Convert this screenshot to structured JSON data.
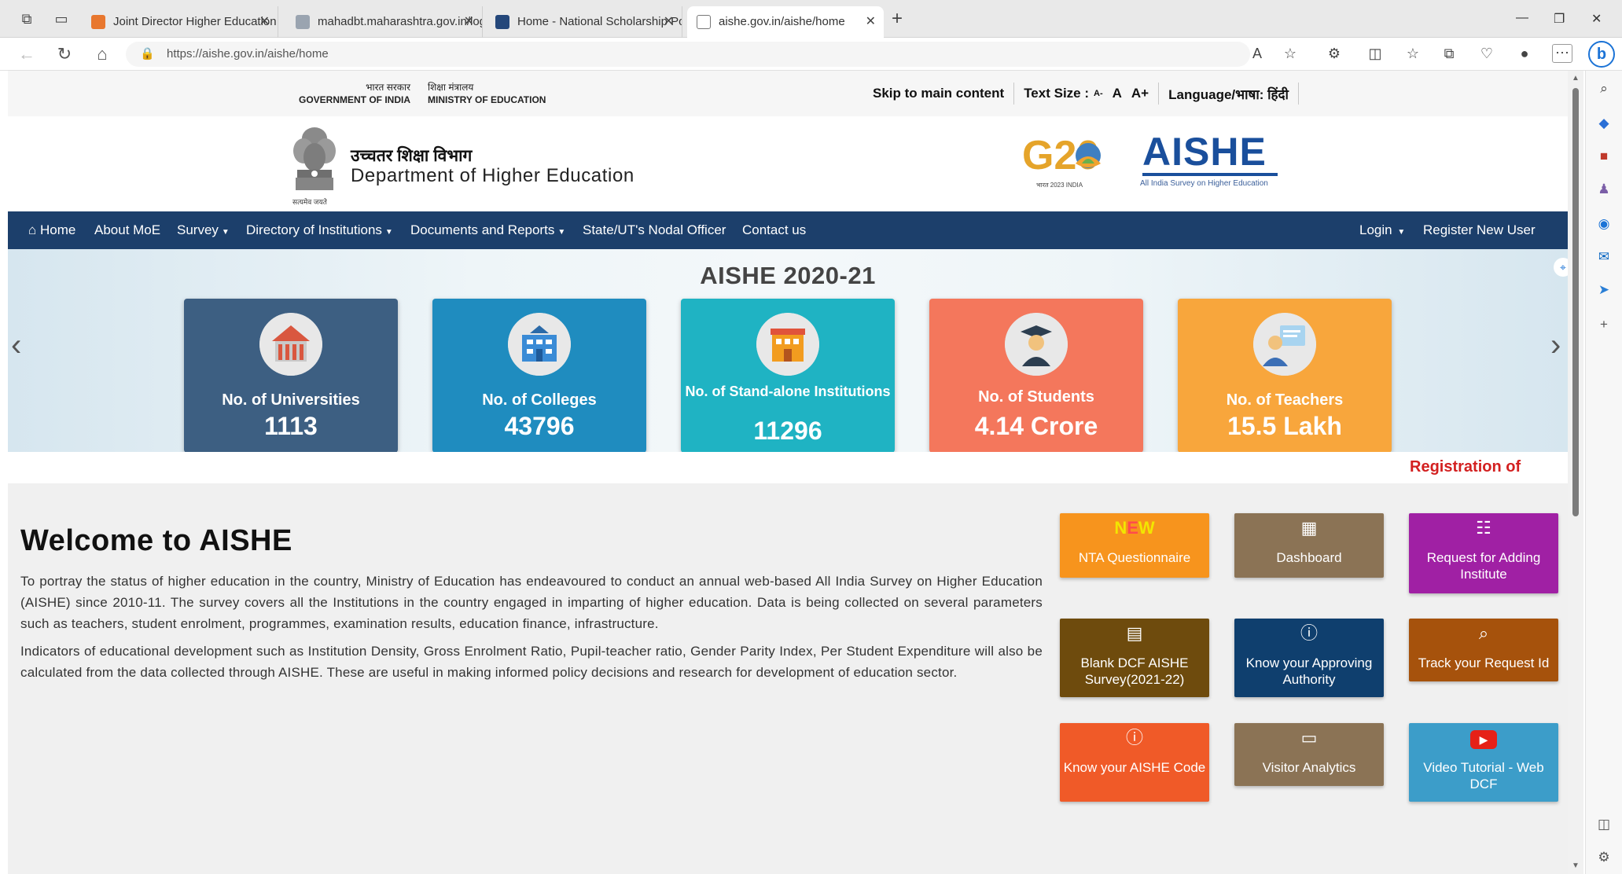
{
  "browser": {
    "tabs": [
      {
        "title": "Joint Director Higher Education ,",
        "favicon_color": "#e8772e",
        "active": false
      },
      {
        "title": "mahadbt.maharashtra.gov.in/log",
        "favicon_color": "#9aa4b0",
        "active": false
      },
      {
        "title": "Home - National Scholarship Por",
        "favicon_color": "#24477a",
        "active": false
      },
      {
        "title": "aishe.gov.in/aishe/home",
        "favicon_color": "#888888",
        "active": true
      }
    ],
    "url": "https://aishe.gov.in/aishe/home"
  },
  "gov": {
    "govt_hi": "भारत सरकार",
    "govt_en": "GOVERNMENT OF INDIA",
    "ministry_hi": "शिक्षा मंत्रालय",
    "ministry_en": "MINISTRY OF EDUCATION",
    "skip": "Skip to main content",
    "text_size": "Text Size :",
    "size_small": "A-",
    "size_normal": "A",
    "size_large": "A+",
    "language": "Language/भाषा: हिंदी"
  },
  "header": {
    "emblem_caption": "सत्यमेव जयते",
    "dept_hi": "उच्चतर शिक्षा विभाग",
    "dept_en": "Department of Higher Education",
    "g20": "G20",
    "g20_caption": "भारत 2023 INDIA",
    "aishe": "AISHE",
    "aishe_sub": "All India Survey on Higher Education"
  },
  "nav": {
    "home": "Home",
    "about": "About MoE",
    "survey": "Survey",
    "directory": "Directory of Institutions",
    "documents": "Documents and Reports",
    "nodal": "State/UT's Nodal Officer",
    "contact": "Contact us",
    "login": "Login",
    "register": "Register New User"
  },
  "slider": {
    "title": "AISHE 2020-21",
    "cards": [
      {
        "label": "No. of Universities",
        "value": "1113",
        "color": "#3d5f82"
      },
      {
        "label": "No. of Colleges",
        "value": "43796",
        "color": "#1f8cbf"
      },
      {
        "label": "No. of Stand-alone Institutions",
        "value": "11296",
        "color": "#1fb3c3"
      },
      {
        "label": "No. of Students",
        "value": "4.14 Crore",
        "color": "#f4775c"
      },
      {
        "label": "No. of Teachers",
        "value": "15.5 Lakh",
        "color": "#f8a63c"
      }
    ]
  },
  "marquee": "Registration of",
  "welcome": {
    "title": "Welcome to AISHE",
    "p1": "To portray the status of higher education in the country, Ministry of Education has endeavoured to conduct an annual web-based All India Survey on Higher Education (AISHE) since 2010-11. The survey covers all the Institutions in the country engaged in imparting of higher education. Data is being collected on several parameters such as teachers, student enrolment, programmes, examination results, education finance, infrastructure.",
    "p2": "Indicators of educational development such as Institution Density, Gross Enrolment Ratio, Pupil-teacher ratio, Gender Parity Index, Per Student Expenditure will also be calculated from the data collected through AISHE. These are useful in making informed policy decisions and research for development of education sector."
  },
  "quick_links": {
    "nta": {
      "label": "NTA Questionnaire",
      "badge_n": "N",
      "badge_e": "E",
      "badge_w": "W",
      "color": "#f7941d"
    },
    "dashboard": {
      "label": "Dashboard",
      "color": "#8b7355"
    },
    "request": {
      "label": "Request for Adding Institute",
      "color": "#a020a4"
    },
    "blank_dcf": {
      "label": "Blank DCF AISHE Survey(2021-22)",
      "color": "#6e4b0d"
    },
    "approving": {
      "label": "Know your Approving Authority",
      "color": "#0f3f6e"
    },
    "track": {
      "label": "Track your Request Id",
      "color": "#a6520c"
    },
    "aishe_code": {
      "label": "Know your AISHE Code",
      "color": "#f05a28"
    },
    "visitor": {
      "label": "Visitor Analytics",
      "color": "#8b7355"
    },
    "video": {
      "label": "Video Tutorial - Web DCF",
      "color": "#3c9dc9"
    }
  }
}
